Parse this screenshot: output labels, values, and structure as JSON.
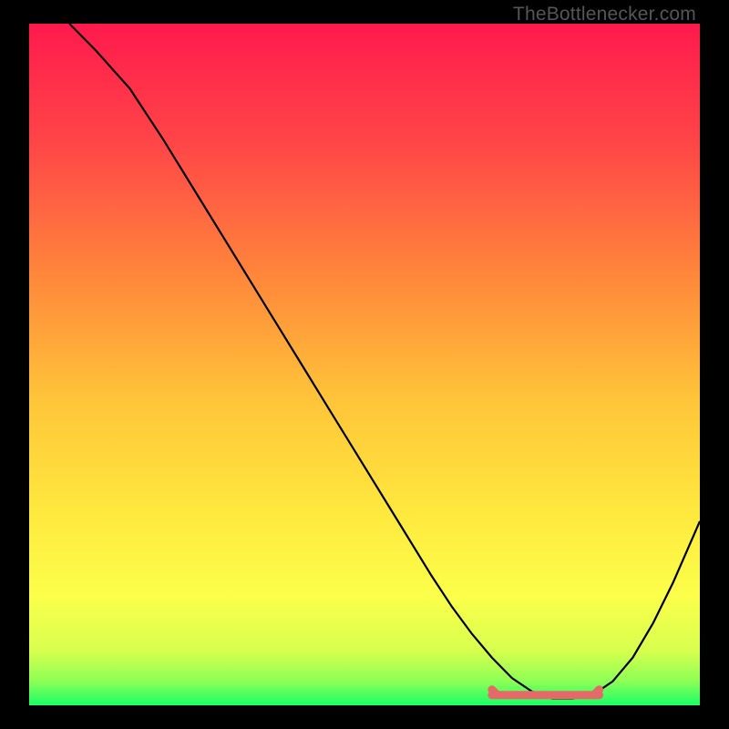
{
  "watermark": "TheBottlenecker.com",
  "chart_data": {
    "type": "line",
    "title": "",
    "xlabel": "",
    "ylabel": "",
    "xlim": [
      0,
      100
    ],
    "ylim": [
      0,
      100
    ],
    "grid": false,
    "legend": false,
    "series": [
      {
        "name": "curve",
        "color": "#000000",
        "x": [
          6,
          10,
          15,
          20,
          25,
          30,
          35,
          40,
          45,
          50,
          55,
          60,
          63,
          66,
          69,
          72,
          75,
          78,
          81,
          84,
          87,
          90,
          93,
          96,
          100
        ],
        "y": [
          100,
          96,
          90.5,
          83,
          75,
          67,
          59,
          51,
          43,
          35,
          27,
          19,
          14.5,
          10.5,
          7,
          4,
          2,
          1,
          1,
          1.5,
          3.5,
          7,
          12,
          18,
          27
        ]
      }
    ],
    "flat_band": {
      "color": "#e46a6a",
      "x_start": 69,
      "x_end": 85,
      "y": 1.5
    },
    "background_gradient": {
      "stops": [
        {
          "offset": 0.0,
          "color": "#ff1a4d"
        },
        {
          "offset": 0.18,
          "color": "#ff4747"
        },
        {
          "offset": 0.38,
          "color": "#ff8a3a"
        },
        {
          "offset": 0.55,
          "color": "#ffc439"
        },
        {
          "offset": 0.72,
          "color": "#ffe93e"
        },
        {
          "offset": 0.84,
          "color": "#fbff4a"
        },
        {
          "offset": 0.92,
          "color": "#d7ff4e"
        },
        {
          "offset": 0.965,
          "color": "#8cff55"
        },
        {
          "offset": 1.0,
          "color": "#1aff66"
        }
      ]
    }
  }
}
